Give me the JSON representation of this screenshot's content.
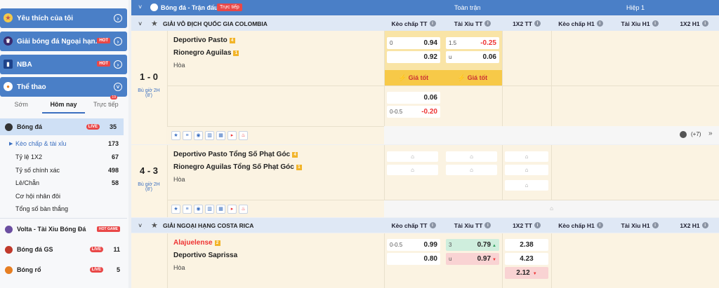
{
  "sidebar": {
    "favorites": "Yêu thích của tôi",
    "premier": "Giải bóng đá Ngoại hạn...",
    "premier_hot": "HOT",
    "nba": "NBA",
    "nba_hot": "HOT",
    "sports": "Thể thao",
    "tabs": [
      "Sớm",
      "Hôm nay",
      "Trực tiếp"
    ],
    "live_tab_count": "19",
    "football": {
      "label": "Bóng đá",
      "live": "LIVE",
      "count": "35"
    },
    "subitems": [
      {
        "label": "Kèo chấp & tài xỉu",
        "count": "173"
      },
      {
        "label": "Tỷ lệ 1X2",
        "count": "67"
      },
      {
        "label": "Tỷ số chính xác",
        "count": "498"
      },
      {
        "label": "Lẻ/Chẵn",
        "count": "58"
      },
      {
        "label": "Cơ hội nhân đôi",
        "count": ""
      },
      {
        "label": "Tổng số bàn thắng",
        "count": ""
      }
    ],
    "volta": {
      "label": "Volta - Tài Xỉu Bóng Đá",
      "tag": "HOT GAME"
    },
    "gs": {
      "label": "Bóng đá GS",
      "live": "LIVE",
      "count": "11"
    },
    "basket": {
      "label": "Bóng rổ",
      "live": "LIVE",
      "count": "5"
    }
  },
  "topbar": {
    "title": "Bóng đá - Trận đấu",
    "live": "Trực tiếp",
    "full": "Toàn trận",
    "half": "Hiệp 1"
  },
  "cols": [
    "Kèo chấp TT",
    "Tài Xỉu TT",
    "1X2 TT",
    "Kèo chấp H1",
    "Tài Xỉu H1",
    "1X2 H1"
  ],
  "league1": "GIẢI VÔ ĐỊCH QUỐC GIA COLOMBIA",
  "league2": "GIẢI NGOẠI HẠNG COSTA RICA",
  "m1": {
    "score": "1 - 0",
    "time": "Bù giờ 2H",
    "min": "(8')",
    "home": "Deportivo Pasto",
    "home_badge": "4",
    "away": "Rionegro Aguilas",
    "away_badge": "1",
    "draw": "Hòa",
    "hc1": {
      "line": "0",
      "home": "0.94",
      "away": "0.92"
    },
    "ou1": {
      "line": "1.5",
      "over": "-0.25",
      "u": "u",
      "under": "0.06"
    },
    "best": "Giá tốt",
    "hc2": {
      "line": "0-0.5",
      "home": "0.06",
      "away": "-0.20"
    },
    "more": "(+7)"
  },
  "m2": {
    "score": "4 - 3",
    "time": "Bù giờ 2H",
    "min": "(8')",
    "home": "Deportivo Pasto Tổng Số Phạt Góc",
    "home_badge": "4",
    "away": "Rionegro Aguilas Tổng Số Phạt Góc",
    "away_badge": "1",
    "draw": "Hòa"
  },
  "m3": {
    "home": "Alajuelense",
    "home_badge": "2",
    "away": "Deportivo Saprissa",
    "draw": "Hòa",
    "hc": {
      "line": "0-0.5",
      "home": "0.99",
      "away": "0.80"
    },
    "ou": {
      "line": "3",
      "over": "0.79",
      "u": "u",
      "under": "0.97"
    },
    "x12": [
      "2.38",
      "4.23",
      "2.12"
    ]
  },
  "colors": {
    "accent": "#4a7fc7",
    "gold": "#f7c948",
    "red": "#e33"
  }
}
